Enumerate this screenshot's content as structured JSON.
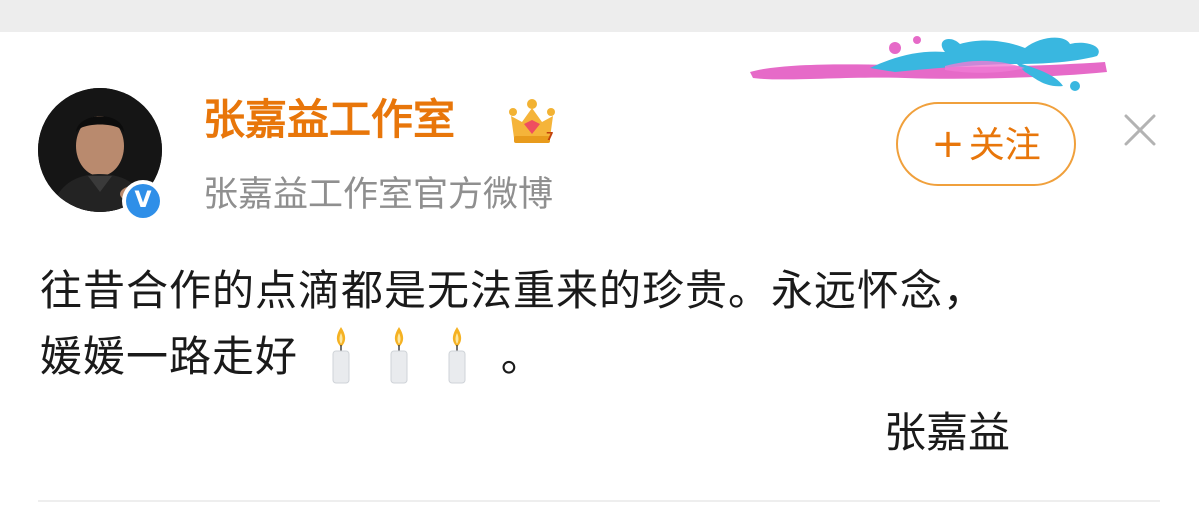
{
  "profile": {
    "name": "张嘉益工作室",
    "subtitle": "张嘉益工作室官方微博",
    "verified_mark": "V"
  },
  "follow_button": {
    "plus": "+",
    "label": "关注"
  },
  "post": {
    "line1": "往昔合作的点滴都是无法重来的珍贵。永远怀念，",
    "line2_text": "媛媛一路走好",
    "line2_end": "。",
    "signature": "张嘉益"
  },
  "icons": {
    "crown": "crown-icon",
    "verified": "verified-badge-icon",
    "close": "close-icon",
    "candle": "candle-icon"
  },
  "colors": {
    "accent_orange": "#e8760a",
    "button_border": "#f0a03c",
    "subtitle_gray": "#8f8f8f",
    "verified_blue": "#2f8fe8",
    "text": "#1a1a1a"
  }
}
